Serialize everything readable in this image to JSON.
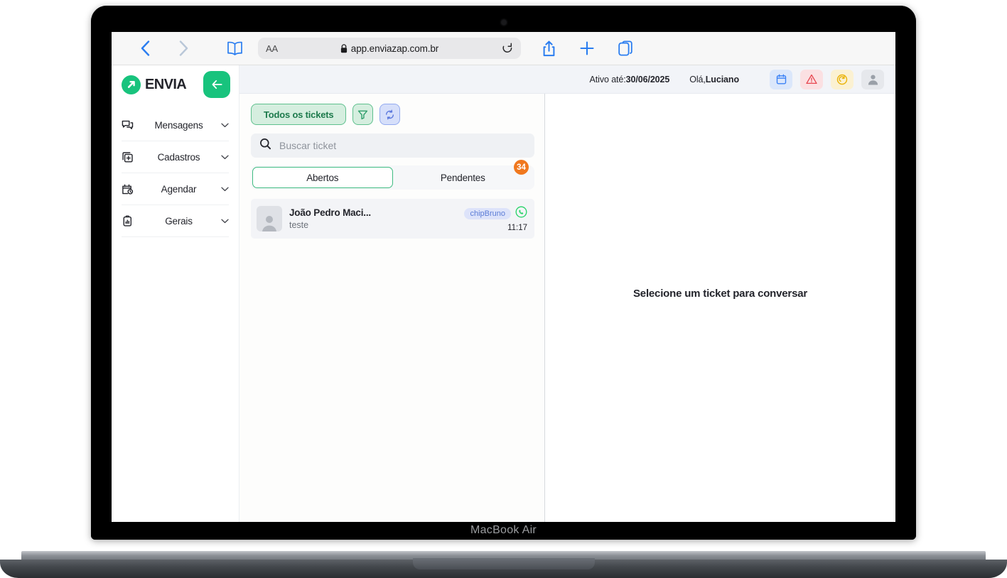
{
  "browser": {
    "back_icon": "chevron-left-icon",
    "forward_icon": "chevron-right-icon",
    "bookmarks_icon": "book-icon",
    "aa_label": "AA",
    "lock_icon": "lock-icon",
    "url": "app.enviazap.com.br",
    "reload_icon": "reload-icon",
    "share_icon": "share-icon",
    "new_tab_icon": "plus-icon",
    "tabs_icon": "tabs-icon"
  },
  "device": {
    "label": "MacBook Air"
  },
  "sidebar": {
    "brand": "ENVIA",
    "logo_icon": "envia-arrow-logo-icon",
    "collapse_icon": "collapse-arrow-left-icon",
    "items": [
      {
        "label": "Mensagens",
        "icon": "chat-bubbles-icon",
        "caret": "chevron-down-icon"
      },
      {
        "label": "Cadastros",
        "icon": "copy-plus-icon",
        "caret": "chevron-down-icon"
      },
      {
        "label": "Agendar",
        "icon": "calendar-clock-icon",
        "caret": "chevron-down-icon"
      },
      {
        "label": "Gerais",
        "icon": "clipboard-chart-icon",
        "caret": "chevron-down-icon"
      }
    ]
  },
  "header": {
    "active_until_prefix": "Ativo até:",
    "active_until_date": "30/06/2025",
    "greeting_prefix": "Olá,",
    "greeting_name": "Luciano",
    "icons": {
      "calendar": "calendar-icon",
      "warning": "warning-triangle-icon",
      "refresh": "refresh-circle-icon",
      "avatar": "user-avatar-icon"
    },
    "colors": {
      "calendar_bg": "#dbe7fb",
      "warning_bg": "#fbe0e2",
      "refresh_bg": "#fbf1d2",
      "avatar_bg": "#e6e8ec"
    }
  },
  "tickets": {
    "all_tickets_label": "Todos os tickets",
    "filter_icon": "filter-funnel-icon",
    "refresh_icon": "refresh-arrows-icon",
    "search": {
      "placeholder": "Buscar ticket",
      "value": "",
      "icon": "search-icon"
    },
    "tabs": [
      {
        "label": "Abertos",
        "active": true,
        "badge": ""
      },
      {
        "label": "Pendentes",
        "active": false,
        "badge": "34"
      }
    ],
    "list": [
      {
        "name": "João Pedro Maci...",
        "preview": "teste",
        "tag": "chipBruno",
        "channel_icon": "whatsapp-icon",
        "time": "11:17",
        "avatar_icon": "user-avatar-icon"
      }
    ]
  },
  "chat": {
    "empty_message": "Selecione um ticket para conversar"
  },
  "theme": {
    "brand_green": "#18c37d",
    "tab_active_border": "#3ebb81",
    "badge_orange": "#f0781e",
    "tag_blue": "#5b7cd6",
    "whatsapp_green": "#25d366",
    "link_blue": "#2a7df0"
  }
}
